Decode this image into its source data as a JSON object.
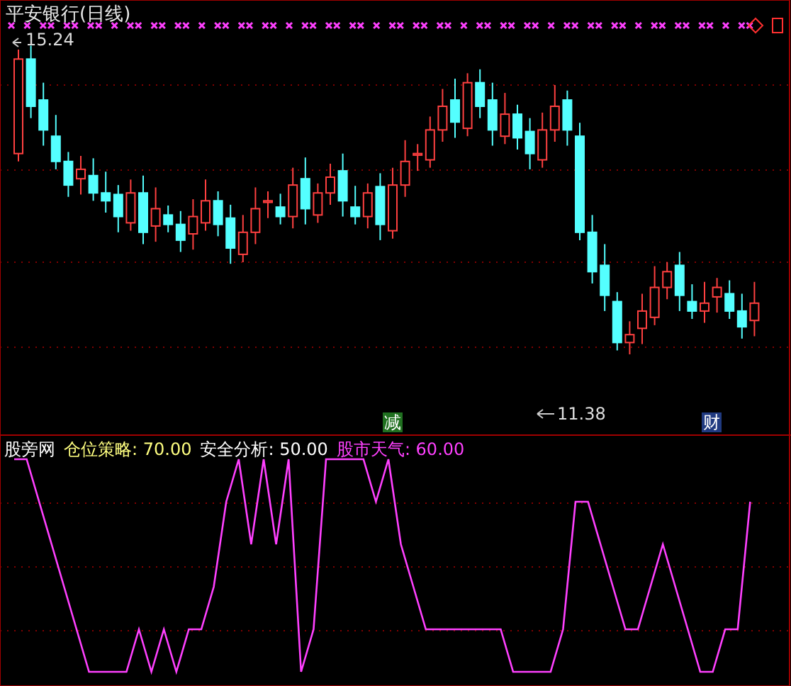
{
  "chart_title": "平安银行(日线)",
  "high_label": "15.24",
  "low_label": "11.38",
  "event_markers": [
    {
      "text": "减",
      "kind": "reduce"
    },
    {
      "text": "财",
      "kind": "finance"
    }
  ],
  "indicator": {
    "name": "股旁网",
    "items": [
      {
        "label": "仓位策略: 70.00",
        "color": "#ffff80"
      },
      {
        "label": "安全分析: 50.00",
        "color": "#ffffff"
      },
      {
        "label": "股市天气: 60.00",
        "color": "#ff40ff"
      }
    ]
  }
}
